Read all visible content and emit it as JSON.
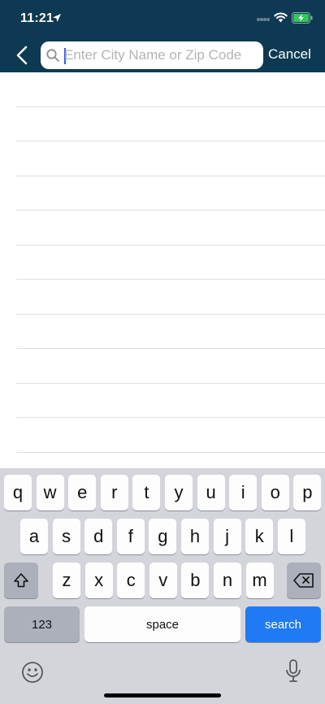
{
  "status_bar": {
    "time": "11:21"
  },
  "nav": {
    "search_placeholder": "Enter City Name or Zip Code",
    "search_value": "",
    "cancel_label": "Cancel"
  },
  "results": {
    "row_count": 11
  },
  "keyboard": {
    "row1": [
      "q",
      "w",
      "e",
      "r",
      "t",
      "y",
      "u",
      "i",
      "o",
      "p"
    ],
    "row2": [
      "a",
      "s",
      "d",
      "f",
      "g",
      "h",
      "j",
      "k",
      "l"
    ],
    "row3": [
      "z",
      "x",
      "c",
      "v",
      "b",
      "n",
      "m"
    ],
    "numbers_label": "123",
    "space_label": "space",
    "action_label": "search"
  },
  "colors": {
    "header": "#0d3a52",
    "action_key": "#1f7af4",
    "battery": "#34c759"
  }
}
